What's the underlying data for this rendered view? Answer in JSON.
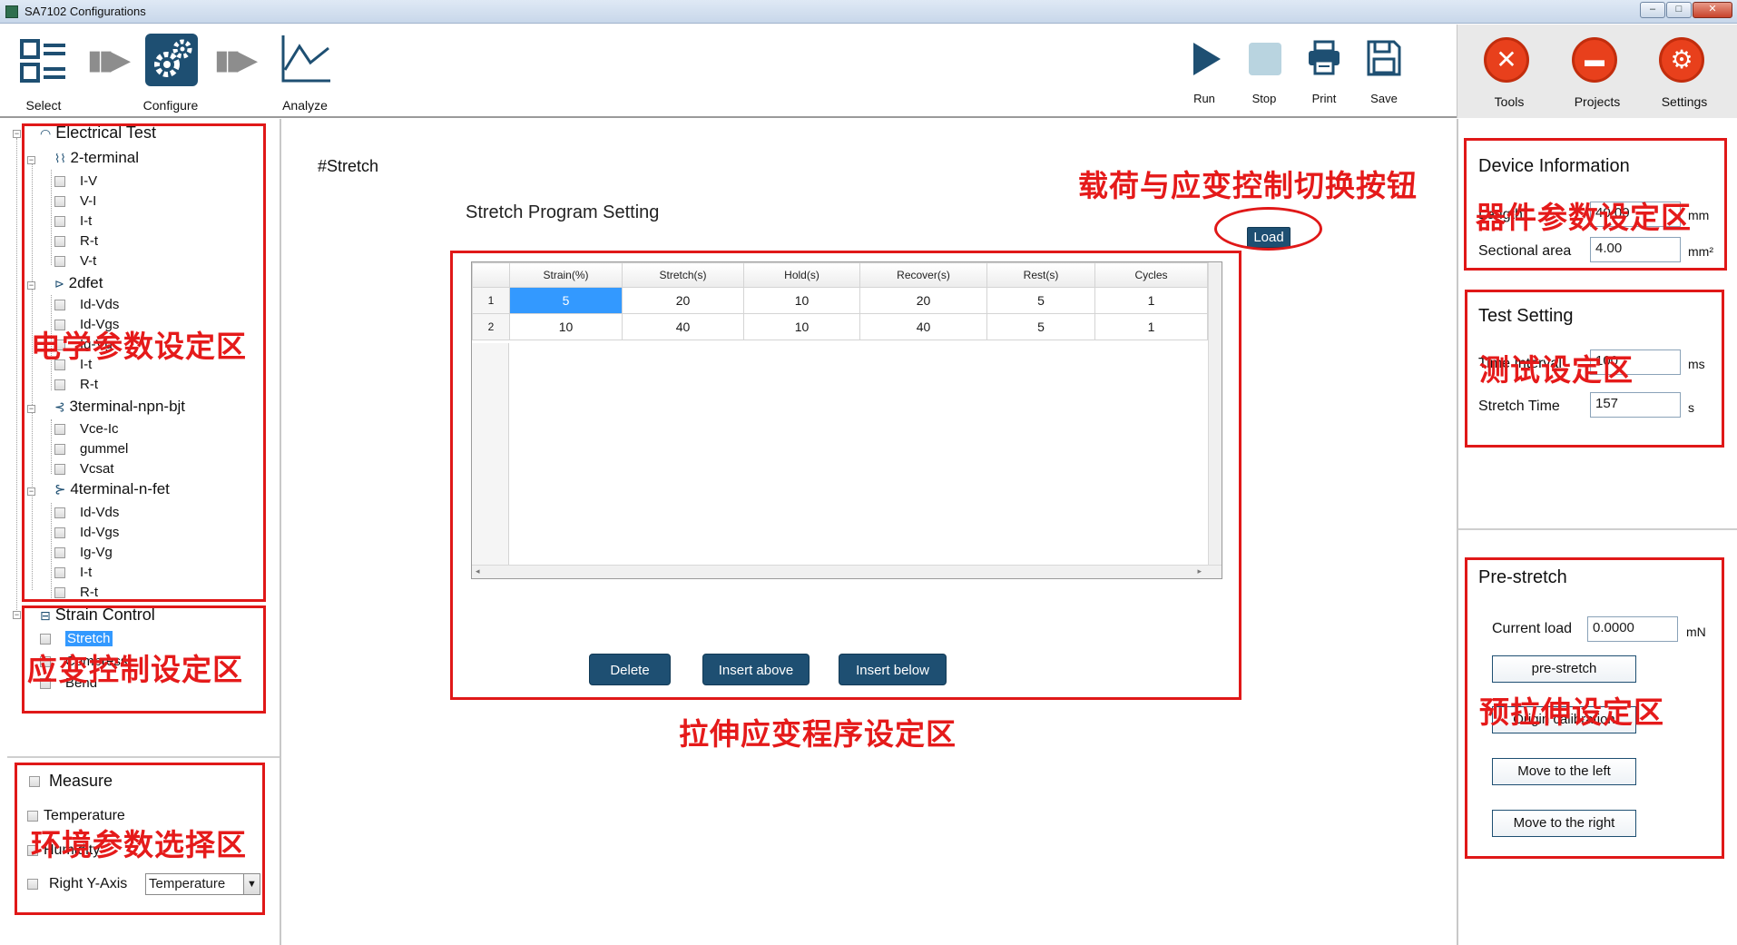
{
  "window": {
    "title": "SA7102 Configurations"
  },
  "toolbar": {
    "select_label": "Select",
    "configure_label": "Configure",
    "analyze_label": "Analyze",
    "run_label": "Run",
    "stop_label": "Stop",
    "print_label": "Print",
    "save_label": "Save",
    "tools_label": "Tools",
    "projects_label": "Projects",
    "settings_label": "Settings"
  },
  "tree": {
    "electrical_root": "Electrical Test",
    "groups": [
      {
        "label": "2-terminal",
        "items": [
          "I-V",
          "V-I",
          "I-t",
          "R-t",
          "V-t"
        ]
      },
      {
        "label": "2dfet",
        "items": [
          "Id-Vds",
          "Id-Vgs",
          "Ig-Vg",
          "I-t",
          "R-t"
        ]
      },
      {
        "label": "3terminal-npn-bjt",
        "items": [
          "Vce-Ic",
          "gummel",
          "Vcsat"
        ]
      },
      {
        "label": "4terminal-n-fet",
        "items": [
          "Id-Vds",
          "Id-Vgs",
          "Ig-Vg",
          "I-t",
          "R-t"
        ]
      }
    ],
    "strain_root": "Strain Control",
    "strain_items": [
      "Stretch",
      "Compress",
      "Bend"
    ]
  },
  "measure": {
    "title": "Measure",
    "temperature": "Temperature",
    "humidity": "Humidity",
    "right_y_axis": "Right Y-Axis",
    "right_y_axis_value": "Temperature"
  },
  "center": {
    "section_tag": "#Stretch",
    "program_title": "Stretch Program Setting",
    "load_button": "Load",
    "table": {
      "columns": [
        "Strain(%)",
        "Stretch(s)",
        "Hold(s)",
        "Recover(s)",
        "Rest(s)",
        "Cycles"
      ],
      "rows": [
        [
          "1",
          "5",
          "20",
          "10",
          "20",
          "5",
          "1"
        ],
        [
          "2",
          "10",
          "40",
          "10",
          "40",
          "5",
          "1"
        ]
      ]
    },
    "delete_button": "Delete",
    "insert_above_button": "Insert above",
    "insert_below_button": "Insert below"
  },
  "device_info": {
    "title": "Device Information",
    "length_label": "Length",
    "length_value": "40.00",
    "length_unit": "mm",
    "area_label": "Sectional area",
    "area_value": "4.00",
    "area_unit": "mm²"
  },
  "test_setting": {
    "title": "Test Setting",
    "interval_label": "Time Interval",
    "interval_value": "100",
    "interval_unit": "ms",
    "stretch_time_label": "Stretch Time",
    "stretch_time_value": "157",
    "stretch_time_unit": "s"
  },
  "pre_stretch": {
    "title": "Pre-stretch",
    "current_load_label": "Current load",
    "current_load_value": "0.0000",
    "current_load_unit": "mN",
    "prestretch_button": "pre-stretch",
    "origin_button": "Origin calibration",
    "move_left_button": "Move to the left",
    "move_right_button": "Move to the right"
  },
  "annotations": {
    "electrical_zone": "电学参数设定区",
    "strain_zone": "应变控制设定区",
    "env_zone": "环境参数选择区",
    "program_zone": "拉伸应变程序设定区",
    "load_switch": "载荷与应变控制切换按钮",
    "device_zone": "器件参数设定区",
    "test_zone": "测试设定区",
    "prestretch_zone": "预拉伸设定区"
  },
  "colors": {
    "accent": "#1e4f72",
    "selection": "#3399ff",
    "annotation_red": "#e01818",
    "tools_orange": "#e8401c"
  }
}
